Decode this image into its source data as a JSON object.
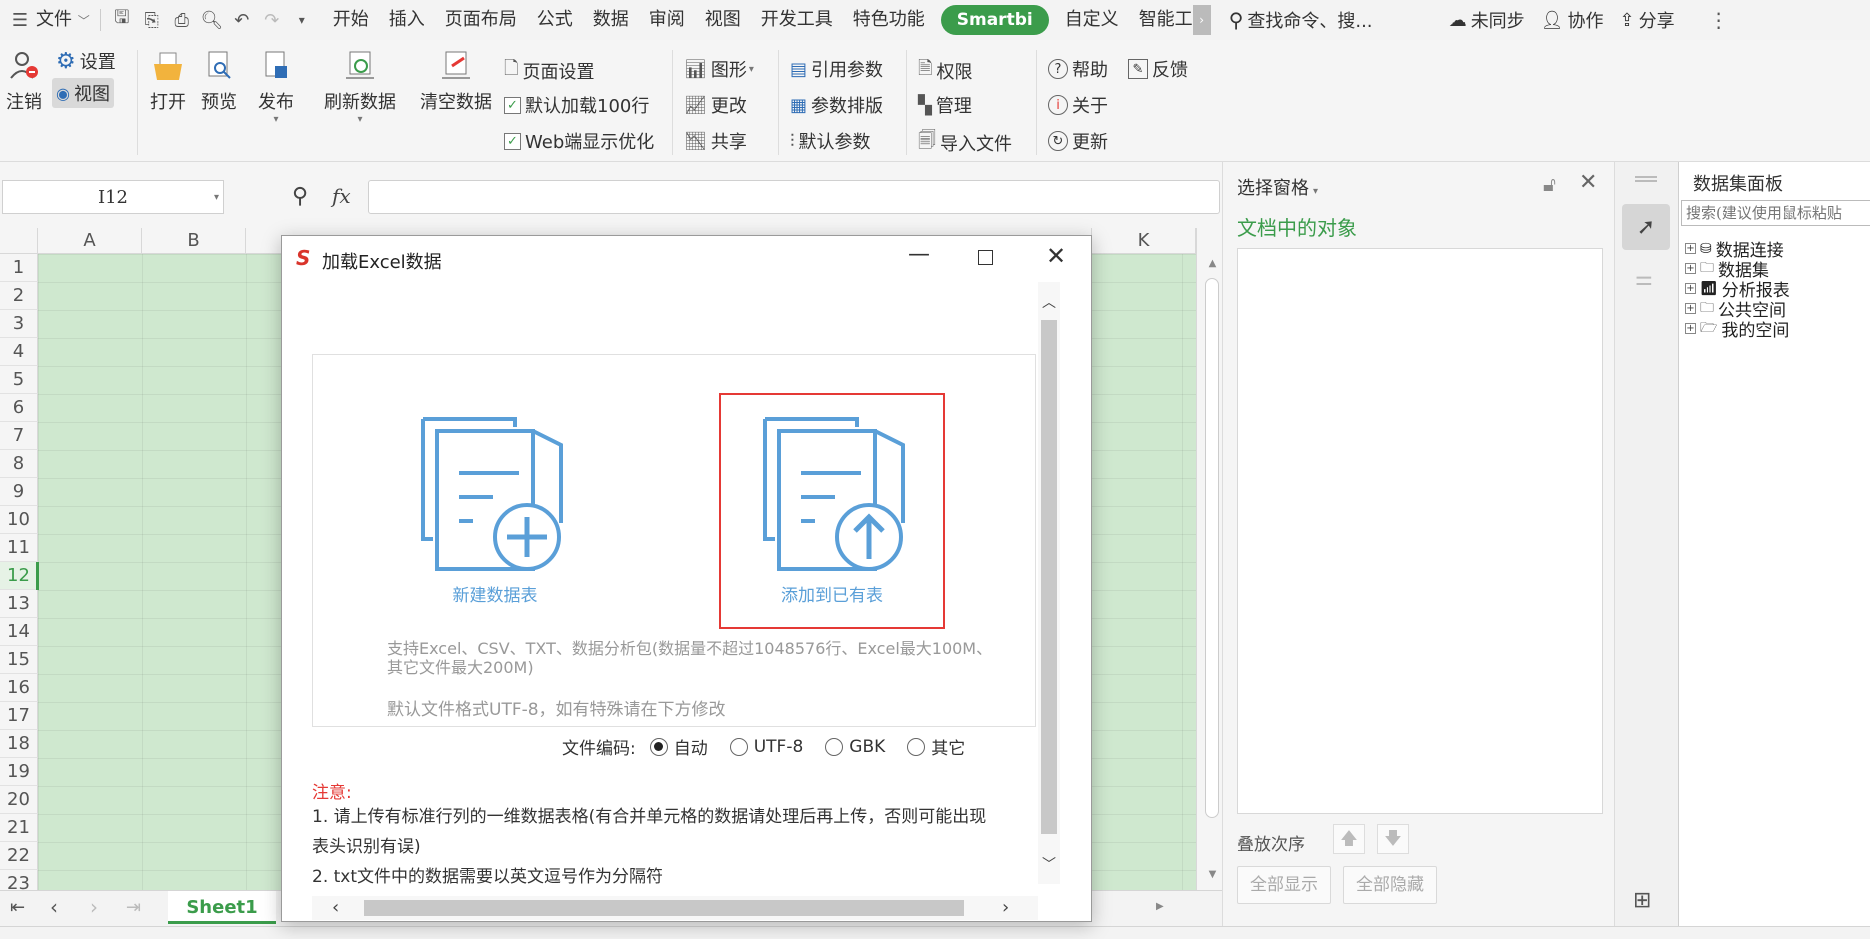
{
  "titlebar": {
    "file_menu": "文件",
    "menus": [
      "开始",
      "插入",
      "页面布局",
      "公式",
      "数据",
      "审阅",
      "视图",
      "开发工具",
      "特色功能"
    ],
    "smartbi_tab": "Smartbi",
    "menus_after": [
      "自定义",
      "智能工"
    ],
    "search_placeholder": "查找命令、搜...",
    "sync": "未同步",
    "collab": "协作",
    "share": "分享"
  },
  "ribbon": {
    "logout": "注销",
    "settings": "设置",
    "view": "视图",
    "open": "打开",
    "preview": "预览",
    "publish": "发布",
    "refresh": "刷新数据",
    "clear": "清空数据",
    "page_setup": "页面设置",
    "default_load": "默认加载100行",
    "web_opt": "Web端显示优化",
    "chart": "图形",
    "change": "更改",
    "share": "共享",
    "ref_param": "引用参数",
    "param_layout": "参数排版",
    "default_param": "默认参数",
    "permission": "权限",
    "manage": "管理",
    "import_file": "导入文件",
    "help": "帮助",
    "feedback": "反馈",
    "about": "关于",
    "update": "更新"
  },
  "formula": {
    "name_box": "I12",
    "fx": "fx"
  },
  "sheet": {
    "columns": [
      "A",
      "B",
      "K"
    ],
    "rows": [
      "1",
      "2",
      "3",
      "4",
      "5",
      "6",
      "7",
      "8",
      "9",
      "10",
      "11",
      "12",
      "13",
      "14",
      "15",
      "16",
      "17",
      "18",
      "19",
      "20",
      "21",
      "22",
      "23"
    ],
    "tab": "Sheet1"
  },
  "selpane": {
    "title": "选择窗格",
    "objects_label": "文档中的对象",
    "order_label": "叠放次序",
    "show_all": "全部显示",
    "hide_all": "全部隐藏"
  },
  "datapanel": {
    "title": "数据集面板",
    "search_placeholder": "搜索(建议使用鼠标粘贴",
    "tree": [
      "数据连接",
      "数据集",
      "分析报表",
      "公共空间",
      "我的空间"
    ]
  },
  "dialog": {
    "title": "加载Excel数据",
    "new_table": "新建数据表",
    "add_existing": "添加到已有表",
    "support_line1": "支持Excel、CSV、TXT、数据分析包(数据量不超过1048576行、Excel最大100M、",
    "support_line2": "其它文件最大200M)",
    "default_encoding": "默认文件格式UTF-8，如有特殊请在下方修改",
    "encoding_label": "文件编码:",
    "encoding_options": [
      "自动",
      "UTF-8",
      "GBK",
      "其它"
    ],
    "note_title": "注意:",
    "note1": "1. 请上传有标准行列的一维数据表格(有合并单元格的数据请处理后再上传，否则可能出现",
    "note1b": "表头识别有误)",
    "note2": "2. txt文件中的数据需要以英文逗号作为分隔符"
  },
  "colors": {
    "accent_green": "#3b9c4b",
    "icon_blue": "#5a9fd8",
    "highlight_red": "#e53935",
    "cell_green": "#cfe8cf"
  }
}
